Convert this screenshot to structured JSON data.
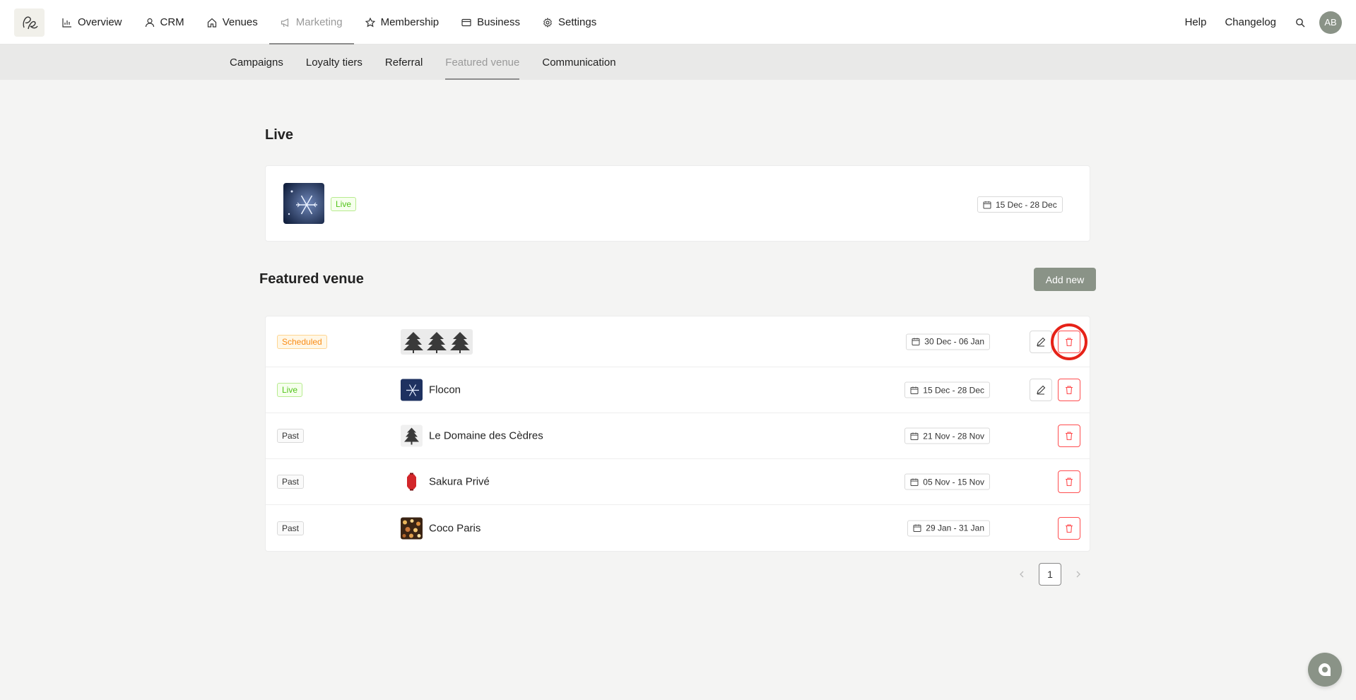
{
  "brand": {
    "logo_icon": "signature-logo",
    "accent": "#8a9387",
    "danger": "#ff4d4f",
    "live_color": "#52c41a",
    "scheduled_color": "#fa8c16"
  },
  "nav": {
    "items": [
      {
        "label": "Overview",
        "icon": "bar-chart-icon"
      },
      {
        "label": "CRM",
        "icon": "user-icon"
      },
      {
        "label": "Venues",
        "icon": "home-icon"
      },
      {
        "label": "Marketing",
        "icon": "megaphone-icon",
        "active": true
      },
      {
        "label": "Membership",
        "icon": "star-icon"
      },
      {
        "label": "Business",
        "icon": "wallet-icon"
      },
      {
        "label": "Settings",
        "icon": "gear-icon"
      }
    ],
    "help": "Help",
    "changelog": "Changelog",
    "avatar_initials": "AB"
  },
  "subnav": {
    "items": [
      {
        "label": "Campaigns"
      },
      {
        "label": "Loyalty tiers"
      },
      {
        "label": "Referral"
      },
      {
        "label": "Featured venue",
        "active": true
      },
      {
        "label": "Communication"
      }
    ]
  },
  "live_section": {
    "title": "Live",
    "status": "Live",
    "dates": "15 Dec - 28 Dec"
  },
  "featured_section": {
    "title": "Featured venue",
    "add_label": "Add new",
    "rows": [
      {
        "status": "Scheduled",
        "status_type": "sched",
        "name": "",
        "thumb": "cedar-trees",
        "dates": "30 Dec - 06 Jan",
        "editable": true,
        "highlighted": true
      },
      {
        "status": "Live",
        "status_type": "live",
        "name": "Flocon",
        "thumb": "snowflake",
        "dates": "15 Dec - 28 Dec",
        "editable": true
      },
      {
        "status": "Past",
        "status_type": "past",
        "name": "Le Domaine des Cèdres",
        "thumb": "cedar-tree",
        "dates": "21 Nov - 28 Nov",
        "editable": false
      },
      {
        "status": "Past",
        "status_type": "past",
        "name": "Sakura Privé",
        "thumb": "red-lantern",
        "dates": "05 Nov - 15 Nov",
        "editable": false
      },
      {
        "status": "Past",
        "status_type": "past",
        "name": "Coco Paris",
        "thumb": "bokeh-lights",
        "dates": "29 Jan - 31 Jan",
        "editable": false
      }
    ]
  },
  "pagination": {
    "current": "1"
  }
}
